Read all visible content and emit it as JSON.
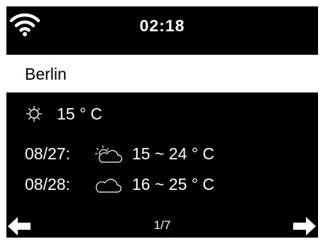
{
  "status": {
    "time": "02:18",
    "wifi_icon": "wifi-icon"
  },
  "location": {
    "city": "Berlin"
  },
  "current": {
    "icon": "sun-icon",
    "temperature": "15 ° C"
  },
  "forecast": [
    {
      "date": "08/27:",
      "icon": "partly-cloudy-icon",
      "range": "15 ~ 24 ° C"
    },
    {
      "date": "08/28:",
      "icon": "cloud-icon",
      "range": "16 ~ 25 ° C"
    }
  ],
  "footer": {
    "page": "1/7",
    "prev_icon": "arrow-left-icon",
    "next_icon": "arrow-right-icon"
  },
  "colors": {
    "screen_background": "#000000",
    "foreground": "#ffffff",
    "highlight_bar": "#ffffff"
  }
}
